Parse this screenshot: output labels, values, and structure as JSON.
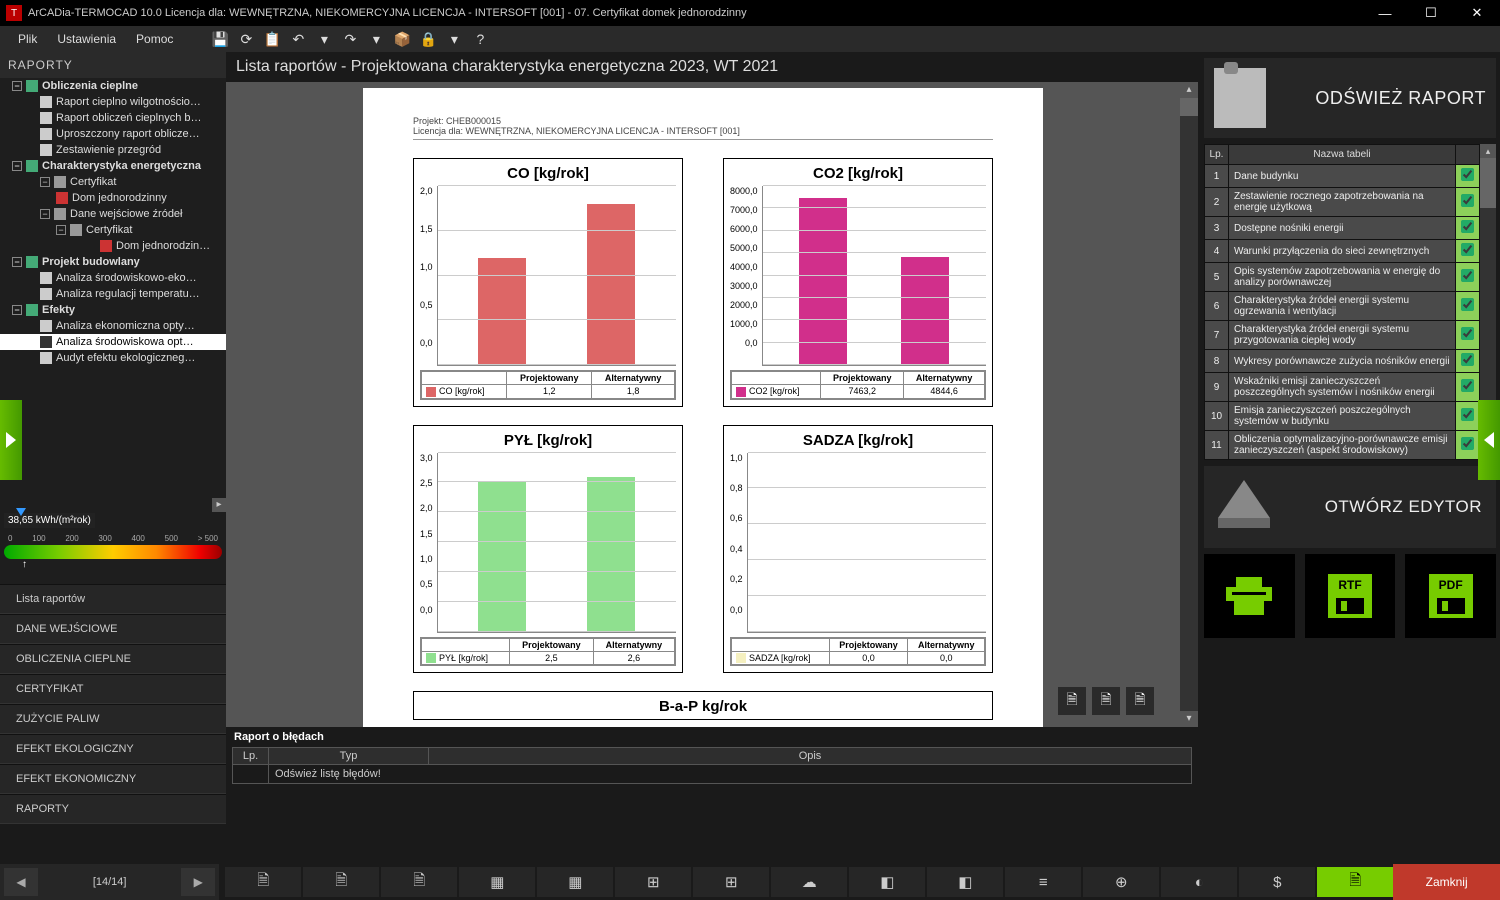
{
  "window": {
    "title": "ArCADia-TERMOCAD 10.0 Licencja dla: WEWNĘTRZNA, NIEKOMERCYJNA LICENCJA - INTERSOFT [001] - 07. Certyfikat domek jednorodzinny"
  },
  "menu": {
    "file": "Plik",
    "settings": "Ustawienia",
    "help": "Pomoc"
  },
  "left_header": "RAPORTY",
  "tree": {
    "n1": "Obliczenia cieplne",
    "n1a": "Raport cieplno wilgotnościo…",
    "n1b": "Raport obliczeń cieplnych b…",
    "n1c": "Uproszczony raport oblicze…",
    "n1d": "Zestawienie przegród",
    "n2": "Charakterystyka energetyczna",
    "n2a": "Certyfikat",
    "n2a1": "Dom jednorodzinny",
    "n2b": "Dane wejściowe źródeł",
    "n2b1": "Certyfikat",
    "n2b1a": "Dom jednorodzin…",
    "n3": "Projekt budowlany",
    "n3a": "Analiza środowiskowo-eko…",
    "n3b": "Analiza regulacji temperatu…",
    "n4": "Efekty",
    "n4a": "Analiza ekonomiczna opty…",
    "n4b": "Analiza środowiskowa opt…",
    "n4c": "Audyt efektu ekologiczneg…"
  },
  "gauge": {
    "value": "38,65 kWh/(m²rok)",
    "ticks": [
      "0",
      "100",
      "200",
      "300",
      "400",
      "500",
      "> 500"
    ]
  },
  "navlist": [
    "Lista raportów",
    "DANE WEJŚCIOWE",
    "OBLICZENIA CIEPLNE",
    "CERTYFIKAT",
    "ZUŻYCIE PALIW",
    "EFEKT EKOLOGICZNY",
    "EFEKT EKONOMICZNY",
    "RAPORTY"
  ],
  "breadcrumb": "Lista raportów - Projektowana charakterystyka energetyczna 2023, WT 2021",
  "page": {
    "project": "Projekt: CHEB000015",
    "license": "Licencja dla: WEWNĘTRZNA, NIEKOMERCYJNA LICENCJA - INTERSOFT [001]",
    "bottom_title": "B-a-P kg/rok"
  },
  "legend_cols": {
    "proj": "Projektowany",
    "alt": "Alternatywny"
  },
  "chart_data": [
    {
      "type": "bar",
      "title": "CO [kg/rok]",
      "categories": [
        "Projektowany",
        "Alternatywny"
      ],
      "series": [
        {
          "name": "CO [kg/rok]",
          "values": [
            1.2,
            1.8
          ]
        }
      ],
      "values_fmt": [
        "1,2",
        "1,8"
      ],
      "ylim": [
        0,
        2.0
      ],
      "yticks": [
        "2,0",
        "1,5",
        "1,0",
        "0,5",
        "0,0"
      ],
      "color": "#d66"
    },
    {
      "type": "bar",
      "title": "CO2 [kg/rok]",
      "categories": [
        "Projektowany",
        "Alternatywny"
      ],
      "series": [
        {
          "name": "CO2 [kg/rok]",
          "values": [
            7463.2,
            4844.6
          ]
        }
      ],
      "values_fmt": [
        "7463,2",
        "4844,6"
      ],
      "ylim": [
        0,
        8000
      ],
      "yticks": [
        "8000,0",
        "7000,0",
        "6000,0",
        "5000,0",
        "4000,0",
        "3000,0",
        "2000,0",
        "1000,0",
        "0,0"
      ],
      "color": "#d12f8b"
    },
    {
      "type": "bar",
      "title": "PYŁ [kg/rok]",
      "categories": [
        "Projektowany",
        "Alternatywny"
      ],
      "series": [
        {
          "name": "PYŁ [kg/rok]",
          "values": [
            2.5,
            2.6
          ]
        }
      ],
      "values_fmt": [
        "2,5",
        "2,6"
      ],
      "ylim": [
        0,
        3.0
      ],
      "yticks": [
        "3,0",
        "2,5",
        "2,0",
        "1,5",
        "1,0",
        "0,5",
        "0,0"
      ],
      "color": "#8fe08f"
    },
    {
      "type": "bar",
      "title": "SADZA [kg/rok]",
      "categories": [
        "Projektowany",
        "Alternatywny"
      ],
      "series": [
        {
          "name": "SADZA [kg/rok]",
          "values": [
            0.0,
            0.0
          ]
        }
      ],
      "values_fmt": [
        "0,0",
        "0,0"
      ],
      "ylim": [
        0,
        1.0
      ],
      "yticks": [
        "1,0",
        "0,8",
        "0,6",
        "0,4",
        "0,2",
        "0,0"
      ],
      "color": "#f5f0c0"
    }
  ],
  "right": {
    "refresh": "ODŚWIEŻ RAPORT",
    "editor": "OTWÓRZ EDYTOR",
    "header_lp": "Lp.",
    "header_name": "Nazwa tabeli",
    "rows": [
      {
        "lp": "1",
        "name": "Dane budynku"
      },
      {
        "lp": "2",
        "name": "Zestawienie rocznego zapotrzebowania na energię użytkową"
      },
      {
        "lp": "3",
        "name": "Dostępne nośniki energii"
      },
      {
        "lp": "4",
        "name": "Warunki przyłączenia do sieci zewnętrznych"
      },
      {
        "lp": "5",
        "name": "Opis systemów zapotrzebowania w energię do analizy porównawczej"
      },
      {
        "lp": "6",
        "name": "Charakterystyka źródeł energii systemu ogrzewania i wentylacji"
      },
      {
        "lp": "7",
        "name": "Charakterystyka źródeł energii systemu przygotowania ciepłej wody"
      },
      {
        "lp": "8",
        "name": "Wykresy porównawcze zużycia nośników energii"
      },
      {
        "lp": "9",
        "name": "Wskaźniki emisji zanieczyszczeń poszczególnych systemów i nośników energii"
      },
      {
        "lp": "10",
        "name": "Emisja zanieczyszczeń poszczególnych systemów w budynku"
      },
      {
        "lp": "11",
        "name": "Obliczenia optymalizacyjno-porównawcze emisji zanieczyszczeń (aspekt środowiskowy)"
      }
    ],
    "export": {
      "rtf": "RTF",
      "pdf": "PDF"
    }
  },
  "errors": {
    "title": "Raport o błędach",
    "col_lp": "Lp.",
    "col_type": "Typ",
    "col_desc": "Opis",
    "row1": "Odśwież listę błędów!"
  },
  "pager": {
    "text": "[14/14]"
  },
  "close_btn": "Zamknij"
}
